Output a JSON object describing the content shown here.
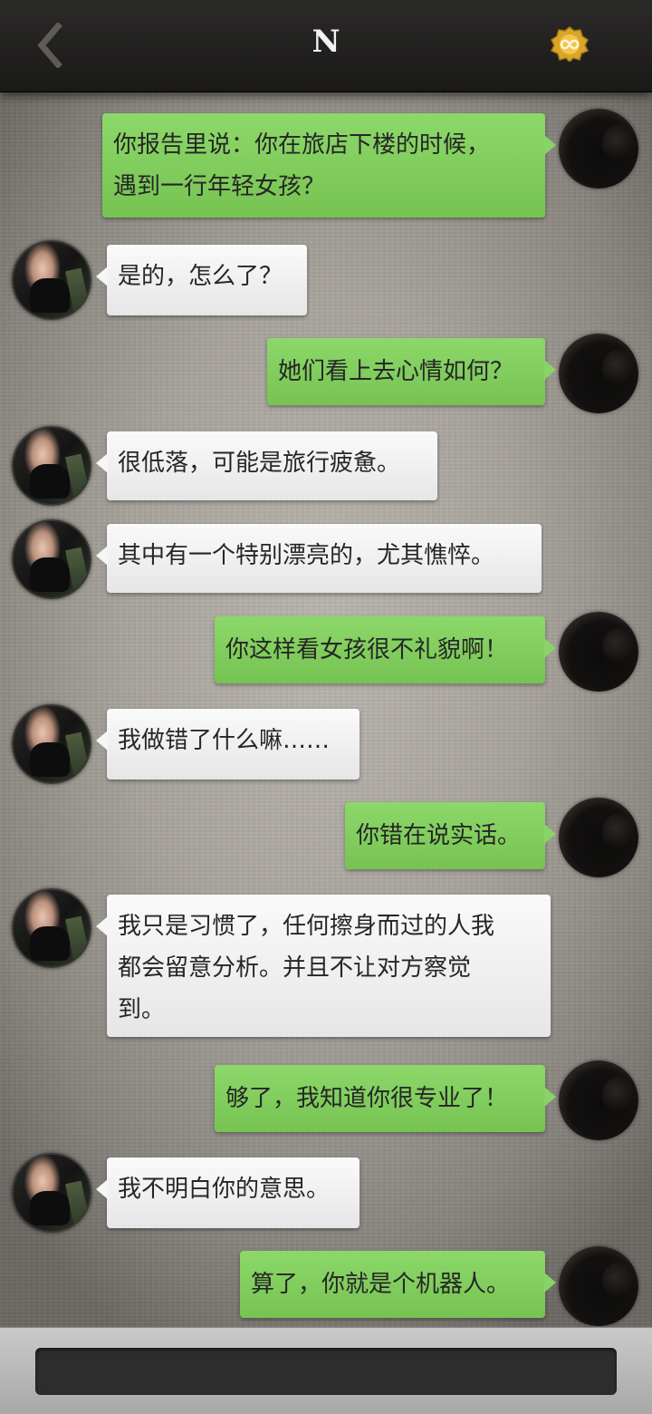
{
  "header": {
    "title": "N",
    "back_icon": "chevron-left-icon",
    "coin_icon": "infinity-coin-icon"
  },
  "messages": [
    {
      "side": "out",
      "text": "你报告里说：你在旅店下楼的时候，\n遇到一行年轻女孩？"
    },
    {
      "side": "in",
      "text": "是的，怎么了？"
    },
    {
      "side": "out",
      "text": "她们看上去心情如何？"
    },
    {
      "side": "in",
      "text": "很低落，可能是旅行疲惫。"
    },
    {
      "side": "in",
      "text": "其中有一个特别漂亮的，尤其憔悴。"
    },
    {
      "side": "out",
      "text": "你这样看女孩很不礼貌啊！"
    },
    {
      "side": "in",
      "text": "我做错了什么嘛……"
    },
    {
      "side": "out",
      "text": "你错在说实话。"
    },
    {
      "side": "in",
      "text": "我只是习惯了，任何擦身而过的人我\n都会留意分析。并且不让对方察觉\n到。"
    },
    {
      "side": "out",
      "text": "够了，我知道你很专业了！"
    },
    {
      "side": "in",
      "text": "我不明白你的意思。"
    },
    {
      "side": "out",
      "text": "算了，你就是个机器人。"
    }
  ],
  "input": {
    "value": "",
    "placeholder": ""
  },
  "colors": {
    "outgoing_bubble": "#80cc5e",
    "incoming_bubble": "#f0f0f0",
    "header": "#222120"
  }
}
